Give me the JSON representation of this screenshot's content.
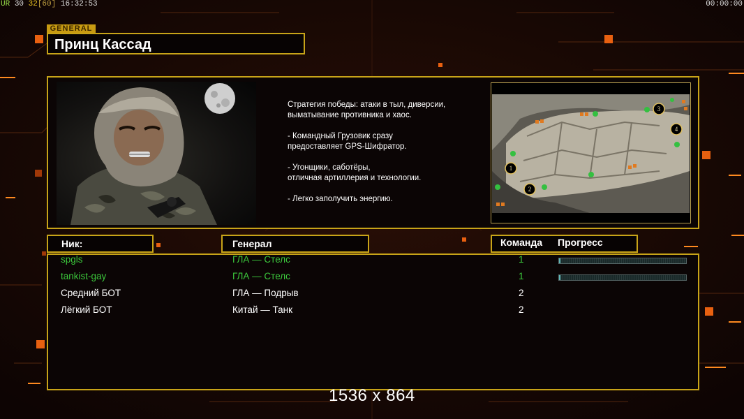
{
  "status": {
    "ur_label": "UR",
    "fps_a": "30",
    "fps_b": "32",
    "fps_cap": "[60]",
    "clock": "16:32:53",
    "timer": "00:00:00"
  },
  "general": {
    "tag": "GENERAL",
    "name": "Принц Кассад"
  },
  "description": [
    "Стратегия победы: атаки в тыл, диверсии,\n выматывание противника и хаос.",
    "- Командный Грузовик сразу\nпредоставляет GPS-Шифратор.",
    "- Угонщики, саботёры,\nотличная артиллерия и технологии.",
    "- Легко заполучить энергию."
  ],
  "map": {
    "start_positions": [
      "1",
      "2",
      "3",
      "4"
    ]
  },
  "columns": {
    "nick": "Ник:",
    "general": "Генерал",
    "team": "Команда",
    "progress": "Прогресс"
  },
  "players": [
    {
      "nick": "spgls",
      "general": "ГЛА — Стелс",
      "team": "1",
      "progress": 0.01,
      "color": "#3cc83c"
    },
    {
      "nick": "tankist-gay",
      "general": "ГЛА — Стелс",
      "team": "1",
      "progress": 0.01,
      "color": "#3cc83c"
    },
    {
      "nick": "Средний БОТ",
      "general": "ГЛА — Подрыв",
      "team": "2",
      "progress": null,
      "color": "#ffffff"
    },
    {
      "nick": "Лёгкий БОТ",
      "general": "Китай — Танк",
      "team": "2",
      "progress": null,
      "color": "#ffffff"
    }
  ],
  "overlay": {
    "resolution": "1536 x 864"
  },
  "colors": {
    "frame_gold": "#c8a418",
    "ally_green": "#3cc83c",
    "progress_teal": "#5fb6b6",
    "accent_orange": "#ff7a10"
  }
}
